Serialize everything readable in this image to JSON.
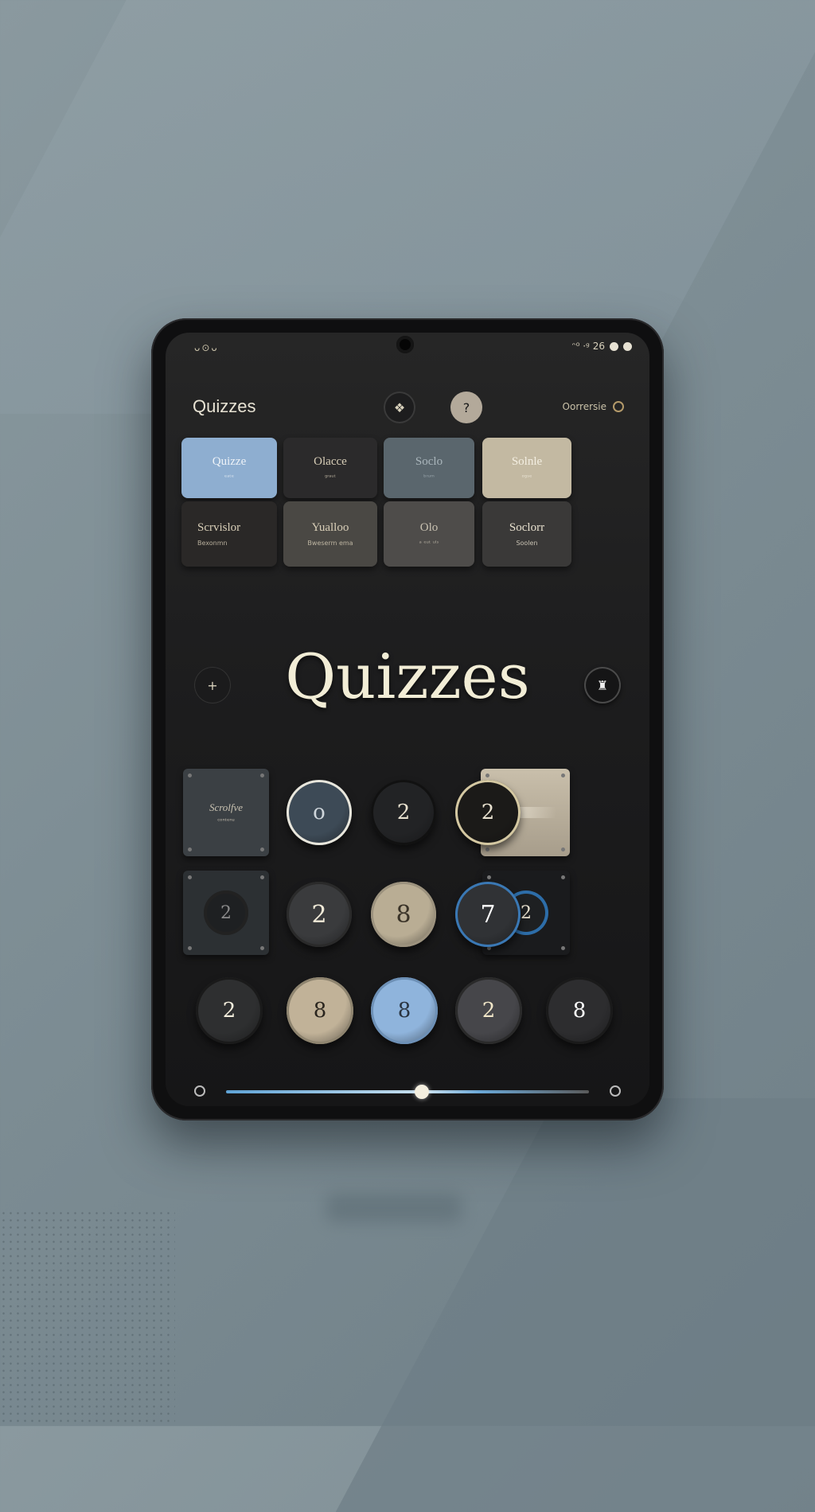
{
  "status_bar": {
    "left": "ᴗ⊙ᴗ",
    "right": "ᵔ⁰ ·ᵍ 26"
  },
  "header": {
    "title": "Quizzes",
    "button_one_icon": "puzzle-icon",
    "button_two_icon": "info-icon",
    "right_label": "Oorrersie"
  },
  "categories": [
    {
      "title": "Quizze",
      "subtitle": "ᵉᵃᵗᵉ",
      "bg": "#8eaed0",
      "fg": "#eef3f8",
      "align": "center"
    },
    {
      "title": "Olacce",
      "subtitle": "ᵍʳᵃᵘᵗ",
      "bg": "#2b2a2b",
      "fg": "#d9cfb8",
      "align": "center"
    },
    {
      "title": "Soclo",
      "subtitle": "ᵇʳᵘᵐ",
      "bg": "#5a666d",
      "fg": "#aab6bc",
      "align": "center"
    },
    {
      "title": "Solnle",
      "subtitle": "ᵒᵍˢᵉ",
      "bg": "#c3b9a2",
      "fg": "#f4efe2",
      "align": "center"
    },
    {
      "title": "Scrvislor",
      "subtitle": "Bexonmn",
      "bg": "#2a2827",
      "fg": "#d9cfb8",
      "align": "left"
    },
    {
      "title": "Yualloo",
      "subtitle": "Bweserm ema",
      "bg": "#4a4844",
      "fg": "#d9cfb8",
      "align": "center"
    },
    {
      "title": "Olo",
      "subtitle": "ᵃ ᵉᵘᵗ ᵘˡˢ",
      "bg": "#4e4c4a",
      "fg": "#c9c2b2",
      "align": "center"
    },
    {
      "title": "Soclorr",
      "subtitle": "Soolen",
      "bg": "#3a3938",
      "fg": "#e8e1cf",
      "align": "center"
    }
  ],
  "main_title": "Quizzes",
  "side_left_icon": "crosshair-icon",
  "side_right_icon": "trophy-icon",
  "tiles": [
    {
      "label": "Scrolfve",
      "sub": "ᶜᵒⁿᵗᵉⁿᵘ",
      "bg": "#3b4044",
      "fg": "#c9c2b2"
    },
    {
      "label": "",
      "sub": "",
      "bg": "#bdb3a0",
      "fg": "#6d665b"
    },
    {
      "label": "2",
      "sub": "",
      "bg": "#2c3033",
      "fg": "#8a8a8a"
    },
    {
      "label": "2",
      "sub": "",
      "bg": "#1a1b1d",
      "fg": "#e8e1cf"
    }
  ],
  "row1_circles": [
    {
      "label": "o",
      "bg": "#3d4a56",
      "fg": "#cfd6db",
      "ring": "#e8e6dc"
    },
    {
      "label": "2",
      "bg": "#222325",
      "fg": "#e8e1cf",
      "ring": "#111111"
    },
    {
      "label": "2",
      "bg": "#1b1a18",
      "fg": "#e8e1cf",
      "ring": "#d4c8a2"
    }
  ],
  "row2_circles": [
    {
      "label": "2",
      "bg": "#3a3b3d",
      "fg": "#f0ead8",
      "ring": "#2a2a2a"
    },
    {
      "label": "8",
      "bg": "#b9ad94",
      "fg": "#3a3328",
      "ring": "#9c927e"
    },
    {
      "label": "7",
      "bg": "#303235",
      "fg": "#ffffff",
      "ring": "#3a78b4"
    }
  ],
  "row3_circles": [
    {
      "label": "2",
      "bg": "#2e2f30",
      "fg": "#f3eedd",
      "ring": "#1a1a1a"
    },
    {
      "label": "8",
      "bg": "#c1b298",
      "fg": "#2a251e",
      "ring": "#8e846f"
    },
    {
      "label": "8",
      "bg": "#8fb4dc",
      "fg": "#2a3440",
      "ring": "#6d90b6"
    },
    {
      "label": "2",
      "bg": "#46464a",
      "fg": "#f0e6c8",
      "ring": "#2a2a2a"
    },
    {
      "label": "8",
      "bg": "#2d2d2f",
      "fg": "#ffffff",
      "ring": "#1a1a1a"
    }
  ],
  "slider": {
    "value": 0.54
  }
}
